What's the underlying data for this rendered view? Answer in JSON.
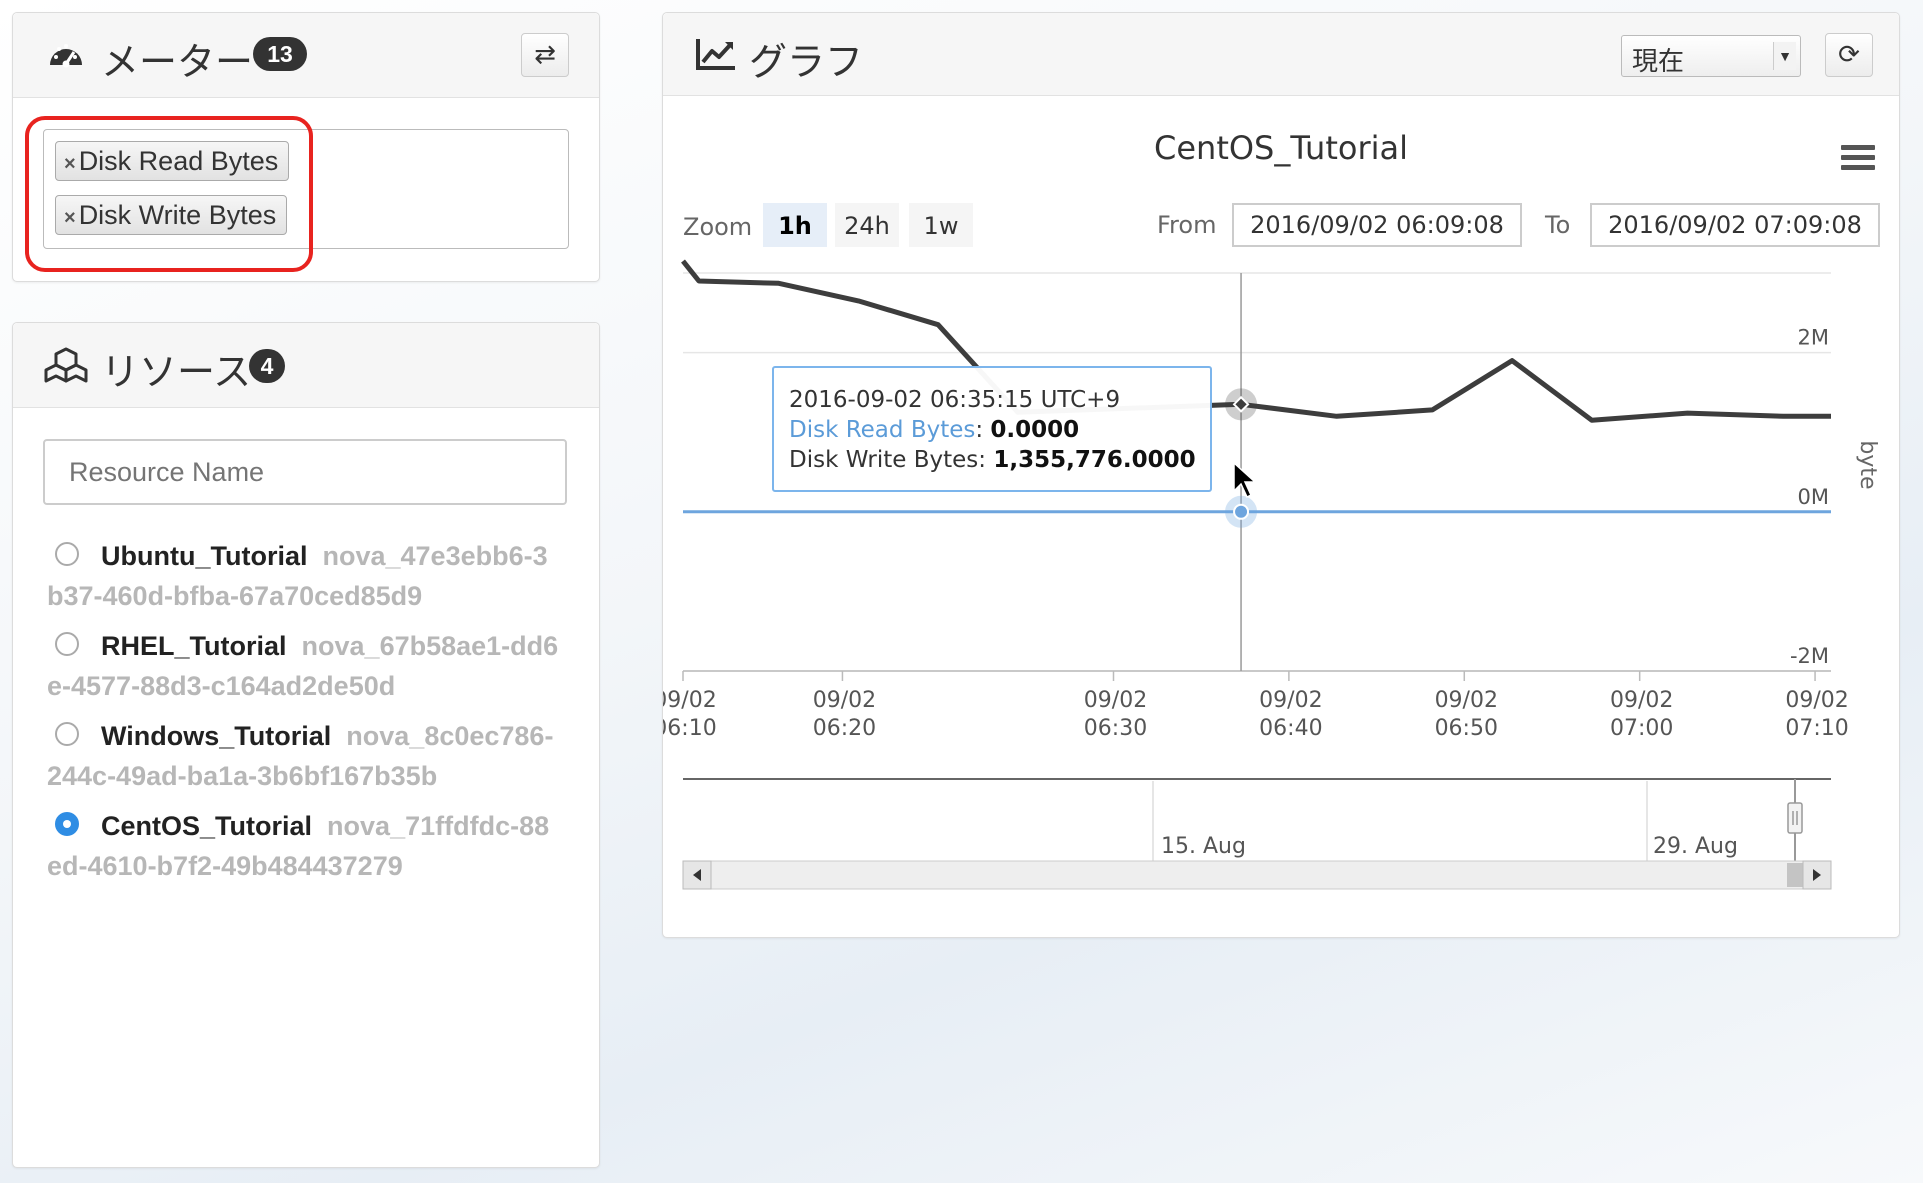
{
  "meters": {
    "title": "メーター",
    "count": "13",
    "selected": [
      "Disk Read Bytes",
      "Disk Write Bytes"
    ],
    "remove_glyph": "×",
    "swap_icon": "swap-icon",
    "highlight_color": "#e8231f"
  },
  "resources": {
    "title": "リソース",
    "count": "4",
    "search_placeholder": "Resource Name",
    "items": [
      {
        "name": "Ubuntu_Tutorial",
        "id_line1": "nova_47e3ebb6-3",
        "id_line2": "b37-460d-bfba-67a70ced85d9",
        "selected": false
      },
      {
        "name": "RHEL_Tutorial",
        "id_line1": "nova_67b58ae1-dd6",
        "id_line2": "e-4577-88d3-c164ad2de50d",
        "selected": false
      },
      {
        "name": "Windows_Tutorial",
        "id_line1": "nova_8c0ec786-",
        "id_line2": "244c-49ad-ba1a-3b6bf167b35b",
        "selected": false
      },
      {
        "name": "CentOS_Tutorial",
        "id_line1": "nova_71ffdfdc-88",
        "id_line2": "ed-4610-b7f2-49b484437279",
        "selected": true
      }
    ]
  },
  "graph": {
    "title": "グラフ",
    "period_value": "現在",
    "refresh_icon": "refresh-icon",
    "chart_title": "CentOS_Tutorial",
    "zoom_label": "Zoom",
    "zoom_options": [
      "1h",
      "24h",
      "1w"
    ],
    "zoom_active": "1h",
    "from_label": "From",
    "from_value": "2016/09/02 06:09:08",
    "to_label": "To",
    "to_value": "2016/09/02 07:09:08",
    "tooltip": {
      "time": "2016-09-02 06:35:15 UTC+9",
      "read_label": "Disk Read Bytes",
      "read_value": "0.0000",
      "write_label": "Disk Write Bytes:",
      "write_value": "1,355,776.0000"
    },
    "navigator_labels": [
      "15. Aug",
      "29. Aug"
    ]
  },
  "chart_data": {
    "type": "line",
    "title": "CentOS_Tutorial",
    "ylabel": "byte",
    "ylim": [
      -2000000,
      3000000
    ],
    "yticks": [
      {
        "value": 2000000,
        "label": "2M"
      },
      {
        "value": 0,
        "label": "0M"
      },
      {
        "value": -2000000,
        "label": "-2M"
      }
    ],
    "xticks": [
      {
        "t": 61,
        "l1": "09/02",
        "l2": "06:10"
      },
      {
        "t": 71,
        "l1": "09/02",
        "l2": "06:20"
      },
      {
        "t": 88,
        "l1": "09/02",
        "l2": "06:30"
      },
      {
        "t": 99,
        "l1": "09/02",
        "l2": "06:40"
      },
      {
        "t": 110,
        "l1": "09/02",
        "l2": "06:50"
      },
      {
        "t": 121,
        "l1": "09/02",
        "l2": "07:00"
      },
      {
        "t": 132,
        "l1": "09/02",
        "l2": "07:10"
      }
    ],
    "x_domain": [
      61,
      133
    ],
    "series": [
      {
        "name": "Disk Write Bytes",
        "color": "#3d3d3d",
        "x": [
          61,
          62,
          67,
          72,
          77,
          82,
          96,
          102,
          108,
          113,
          118,
          124,
          130,
          133
        ],
        "values": [
          3150000,
          2900000,
          2870000,
          2650000,
          2350000,
          1250000,
          1350000,
          1200000,
          1280000,
          1900000,
          1150000,
          1240000,
          1200000,
          1200000
        ]
      },
      {
        "name": "Disk Read Bytes",
        "color": "#6ea5de",
        "x": [
          61,
          133
        ],
        "values": [
          0,
          0
        ]
      }
    ],
    "crosshair_x": 96,
    "grid": true
  }
}
